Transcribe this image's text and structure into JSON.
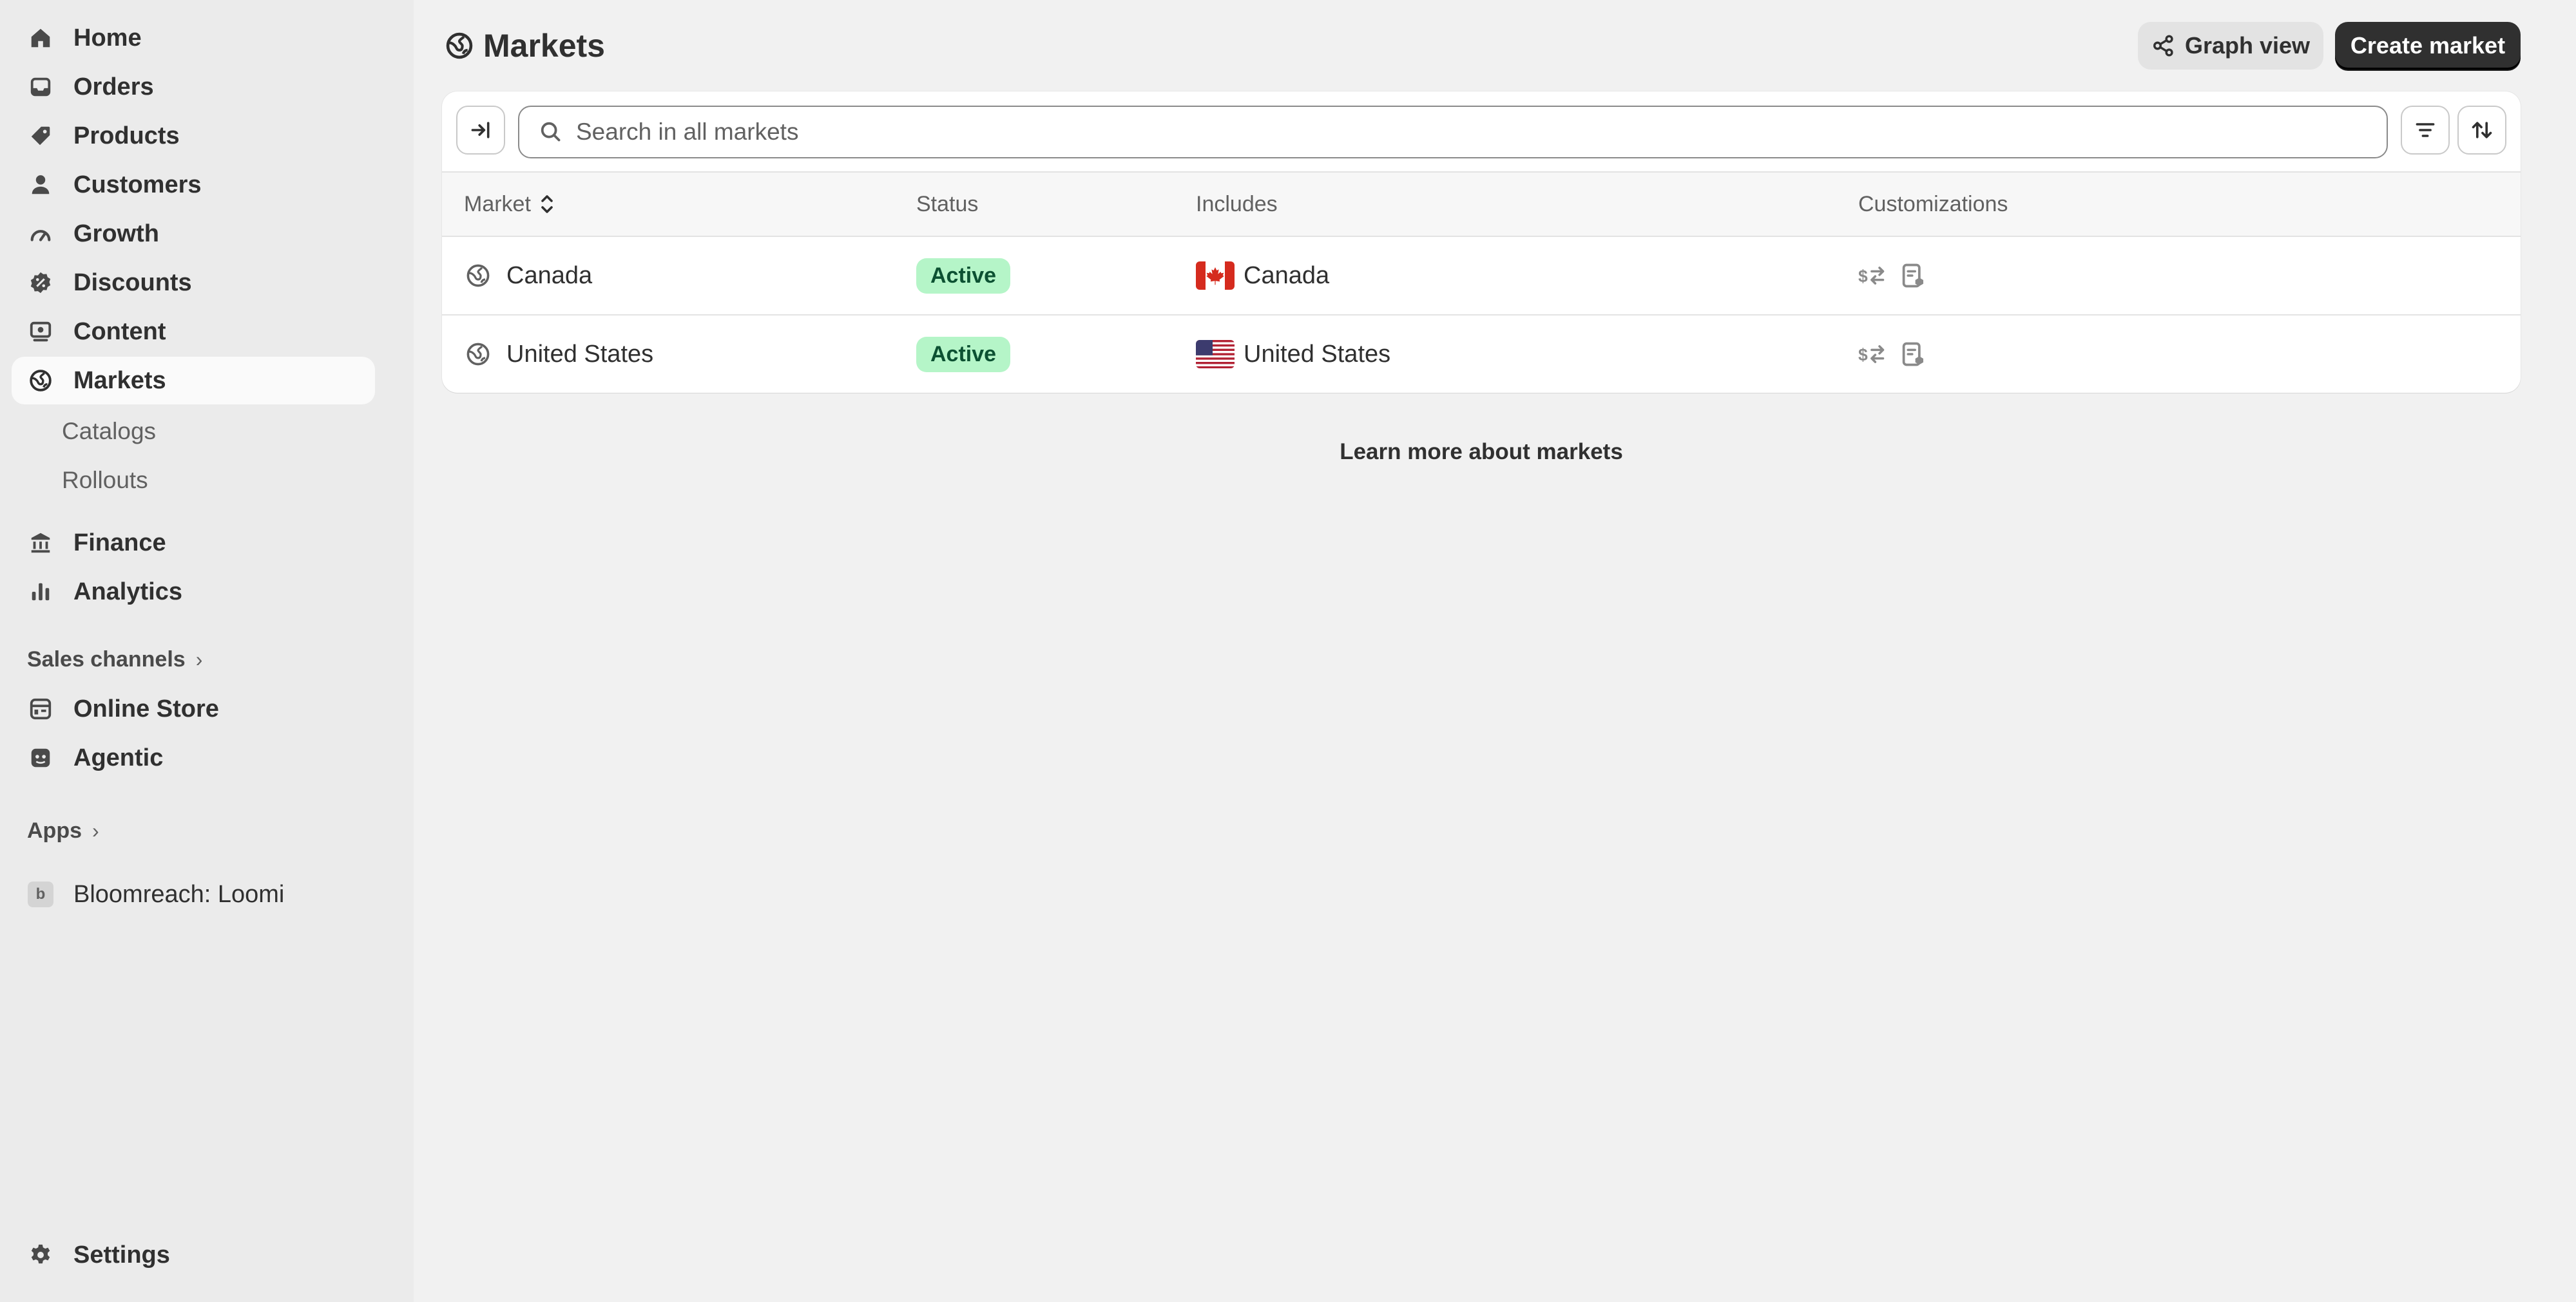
{
  "sidebar": {
    "items": [
      {
        "label": "Home",
        "icon": "home-icon"
      },
      {
        "label": "Orders",
        "icon": "inbox-icon"
      },
      {
        "label": "Products",
        "icon": "tag-icon"
      },
      {
        "label": "Customers",
        "icon": "person-icon"
      },
      {
        "label": "Growth",
        "icon": "gauge-icon"
      },
      {
        "label": "Discounts",
        "icon": "discount-icon"
      },
      {
        "label": "Content",
        "icon": "content-icon"
      },
      {
        "label": "Markets",
        "icon": "globe-icon",
        "active": true
      }
    ],
    "sub_items": [
      {
        "label": "Catalogs"
      },
      {
        "label": "Rollouts"
      }
    ],
    "items_2": [
      {
        "label": "Finance",
        "icon": "bank-icon"
      },
      {
        "label": "Analytics",
        "icon": "bar-chart-icon"
      }
    ],
    "sales_channels": {
      "heading": "Sales channels",
      "items": [
        {
          "label": "Online Store",
          "icon": "store-icon"
        },
        {
          "label": "Agentic",
          "icon": "agentic-icon"
        }
      ]
    },
    "apps": {
      "heading": "Apps",
      "items": [
        {
          "label": "Bloomreach: Loomi",
          "badge": "b"
        }
      ]
    },
    "settings": {
      "label": "Settings",
      "icon": "gear-icon"
    }
  },
  "header": {
    "title": "Markets",
    "graph_view_label": "Graph view",
    "create_market_label": "Create market"
  },
  "search": {
    "placeholder": "Search in all markets",
    "value": ""
  },
  "table": {
    "columns": [
      "Market",
      "Status",
      "Includes",
      "Customizations"
    ],
    "rows": [
      {
        "market": "Canada",
        "status": "Active",
        "includes": "Canada",
        "flag": "canada-flag-icon",
        "customizations": [
          "currency-exchange-icon",
          "catalog-icon"
        ]
      },
      {
        "market": "United States",
        "status": "Active",
        "includes": "United States",
        "flag": "us-flag-icon",
        "customizations": [
          "currency-exchange-icon",
          "catalog-icon"
        ]
      }
    ]
  },
  "footer": {
    "learn_more": "Learn more about markets"
  },
  "colors": {
    "sidebar_bg": "#ebebeb",
    "main_bg": "#f1f1f1",
    "primary_button": "#303030",
    "active_badge_bg": "#b5f5c8",
    "active_badge_text": "#0c5132"
  }
}
